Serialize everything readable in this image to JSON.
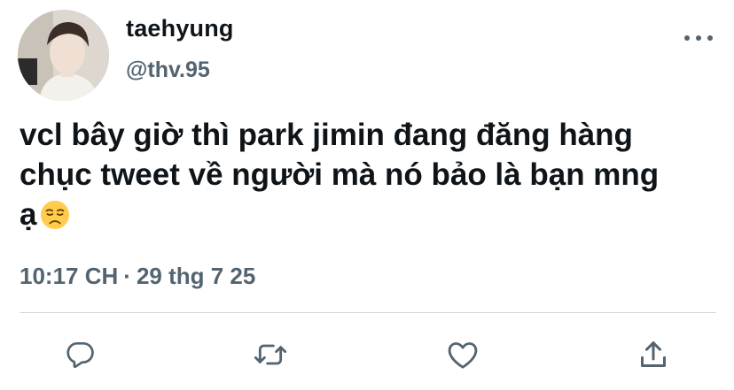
{
  "author": {
    "display_name": "taehyung",
    "handle": "@thv.95"
  },
  "tweet": {
    "lines": [
      "vcl bây giờ thì park jimin đang đăng hàng",
      "chục tweet về người mà nó bảo là bạn mng",
      "ạ"
    ],
    "emoji": "disappointed-face-emoji"
  },
  "meta": {
    "time": "10:17 CH",
    "separator": "·",
    "date": "29 thg 7 25"
  },
  "icons": {
    "more": "more-horizontal-icon",
    "reply": "reply-icon",
    "retweet": "retweet-icon",
    "like": "heart-icon",
    "share": "share-icon"
  },
  "colors": {
    "text": "#0f1419",
    "secondary": "#536471",
    "divider": "#cfd9de"
  }
}
